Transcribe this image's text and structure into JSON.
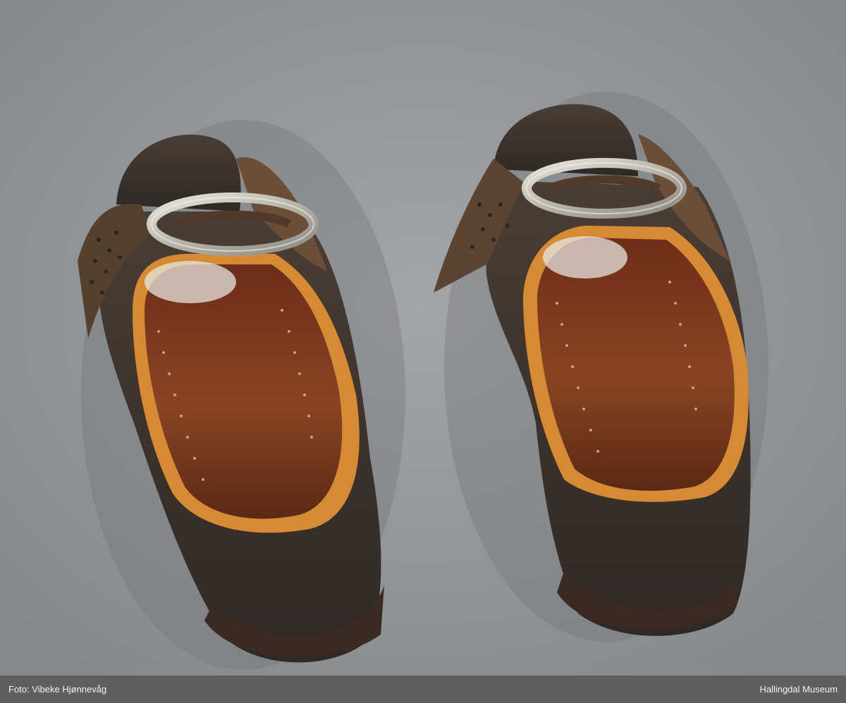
{
  "photo": {
    "subject": "pair of leather shoes with silver buckles",
    "background_color": "#8e9194"
  },
  "caption": {
    "credit": "Foto: Vibeke Hjønnevåg",
    "institution": "Hallingdal Museum",
    "bar_color": "#5d5f61"
  }
}
